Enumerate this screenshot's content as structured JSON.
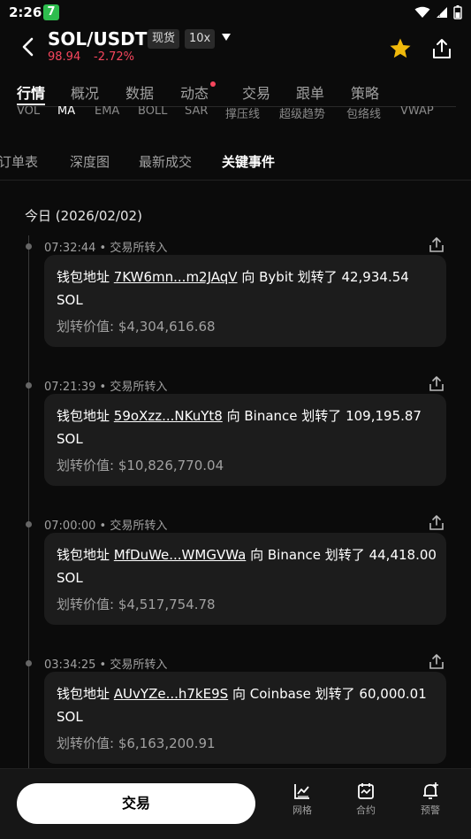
{
  "status_bar": {
    "time": "2:26",
    "app_badge": "7"
  },
  "header": {
    "pair": "SOL/USDT",
    "tag_spot": "现货",
    "tag_leverage": "10x",
    "price": "98.94",
    "change": "-2.72%"
  },
  "main_tabs": [
    "行情",
    "概况",
    "数据",
    "动态",
    "交易",
    "跟单",
    "策略"
  ],
  "indicators": [
    "VOL",
    "MA",
    "EMA",
    "BOLL",
    "SAR",
    "撑压线",
    "超级趋势",
    "包络线",
    "VWAP"
  ],
  "sub_tabs": [
    "订单表",
    "深度图",
    "最新成交",
    "关键事件"
  ],
  "day_title": "今日 (2026/02/02)",
  "events": [
    {
      "time": "07:32:44",
      "type": "交易所转入",
      "prefix": "钱包地址",
      "address": "7KW6mn...m2JAqV",
      "to_word": "向",
      "exchange": "Bybit",
      "verb": "划转了",
      "amount": "42,934.54",
      "unit": "SOL",
      "value_label": "划转价值:",
      "value": "$4,304,616.68"
    },
    {
      "time": "07:21:39",
      "type": "交易所转入",
      "prefix": "钱包地址",
      "address": "59oXzz...NKuYt8",
      "to_word": "向",
      "exchange": "Binance",
      "verb": "划转了",
      "amount": "109,195.87",
      "unit": "SOL",
      "value_label": "划转价值:",
      "value": "$10,826,770.04"
    },
    {
      "time": "07:00:00",
      "type": "交易所转入",
      "prefix": "钱包地址",
      "address": "MfDuWe...WMGVWa",
      "to_word": "向",
      "exchange": "Binance",
      "verb": "划转了",
      "amount": "44,418.00",
      "unit": "SOL",
      "value_label": "划转价值:",
      "value": "$4,517,754.78"
    },
    {
      "time": "03:34:25",
      "type": "交易所转入",
      "prefix": "钱包地址",
      "address": "AUvYZe...h7kE9S",
      "to_word": "向",
      "exchange": "Coinbase",
      "verb": "划转了",
      "amount": "60,000.01",
      "unit": "SOL",
      "value_label": "划转价值:",
      "value": "$6,163,200.91"
    }
  ],
  "bottom_bar": {
    "trade_label": "交易",
    "nav": [
      {
        "label": "网格",
        "icon": "grid-chart-icon"
      },
      {
        "label": "合约",
        "icon": "futures-icon"
      },
      {
        "label": "预警",
        "icon": "alert-bell-icon"
      }
    ]
  },
  "colors": {
    "accent_red": "#f6465d",
    "star": "#f0b90b"
  }
}
